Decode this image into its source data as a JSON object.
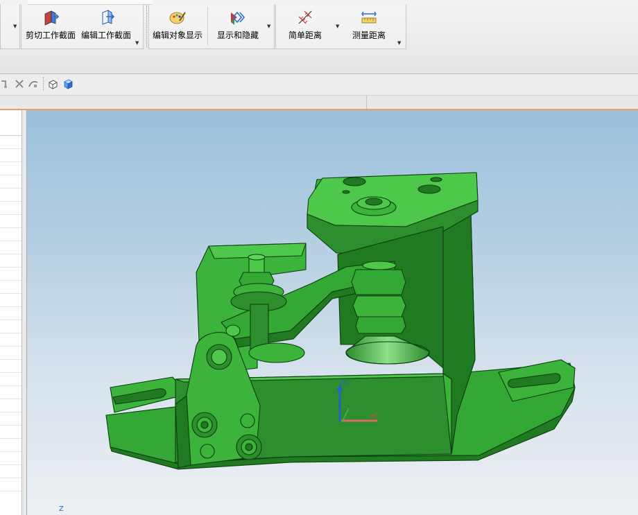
{
  "ribbon": {
    "buttons": {
      "clip_section": "剪切工作截面",
      "edit_section": "编辑工作截面",
      "edit_object_display": "编辑对象显示",
      "show_hide": "显示和隐藏",
      "simple_distance": "简单距离",
      "measure_distance": "测量距离"
    }
  },
  "viewport": {
    "csys_labels": {
      "zc": "ZC",
      "xc": "XC",
      "c": "C",
      "z": "Z"
    }
  },
  "colors": {
    "model": "#3cb43c",
    "model_dark": "#1f7a22",
    "accent_tab": "#e59f68"
  }
}
